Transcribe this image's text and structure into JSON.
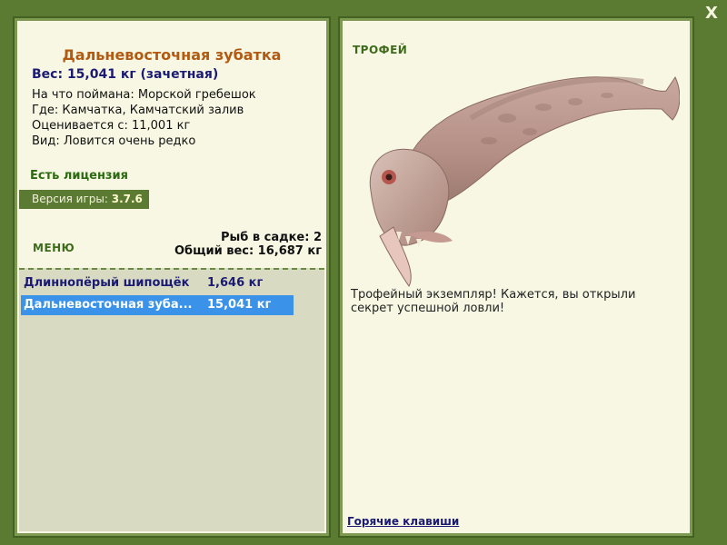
{
  "fish": {
    "title": "Дальневосточная зубатка",
    "weight": "Вес: 15,041 кг (зачетная)",
    "info": [
      "На что поймана: Морской гребешок",
      "Где: Камчатка, Камчатский залив",
      "Оценивается с: 11,001 кг",
      "Вид: Ловится очень редко"
    ]
  },
  "license": "Есть лицензия",
  "version": {
    "label": "Версия игры:",
    "value": "3.7.6"
  },
  "menu_label": "МЕНЮ",
  "cage": {
    "count": "Рыб в садке: 2",
    "total": "Общий вес: 16,687 кг"
  },
  "catch_list": [
    {
      "name": "Длиннопёрый шипощёк",
      "weight": "1,646 кг"
    },
    {
      "name": "Дальневосточная зуба...",
      "weight": "15,041 кг"
    }
  ],
  "trophy_label": "ТРОФЕЙ",
  "trophy_text": "Трофейный экземпляр! Кажется, вы открыли секрет успешной ловли!",
  "hotkeys_link": "Горячие клавиши",
  "close_label": "X",
  "colors": {
    "background": "#5b7a32",
    "panel": "#f7f7e3",
    "title": "#b25a12",
    "selection": "#3a93e8",
    "link": "#1b1b74"
  }
}
